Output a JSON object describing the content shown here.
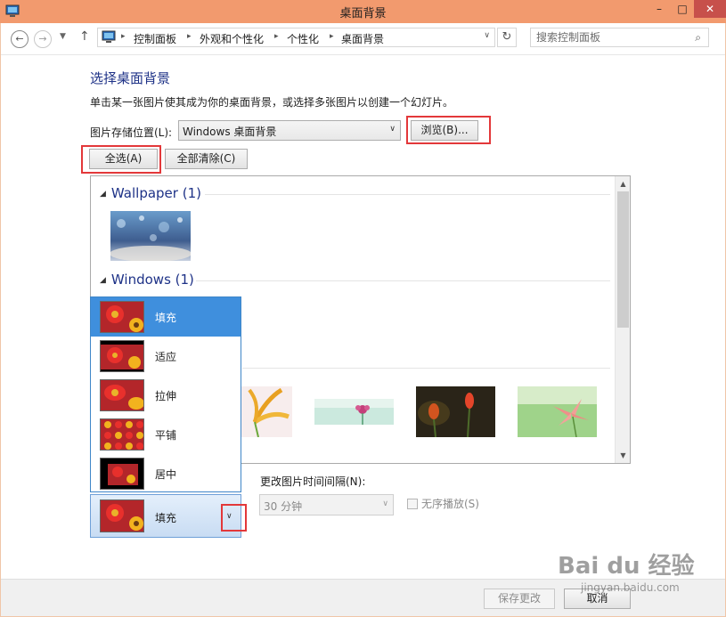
{
  "window": {
    "title": "桌面背景",
    "minimize": "–",
    "maximize": "□",
    "close": "✕"
  },
  "address": {
    "back": "←",
    "forward": "→",
    "history": "▼",
    "up": "↑",
    "breadcrumbs": [
      "控制面板",
      "外观和个性化",
      "个性化",
      "桌面背景"
    ],
    "separator": "▸",
    "dropdown": "∨",
    "refresh": "↻",
    "search_placeholder": "搜索控制面板",
    "search_icon": "⌕"
  },
  "main": {
    "heading": "选择桌面背景",
    "description": "单击某一张图片使其成为你的桌面背景，或选择多张图片以创建一个幻灯片。",
    "location_label": "图片存储位置(L):",
    "location_value": "Windows 桌面背景",
    "location_arrow": "∨",
    "browse_label": "浏览(B)...",
    "select_all_label": "全选(A)",
    "clear_all_label": "全部清除(C)"
  },
  "gallery": {
    "groups": [
      {
        "label": "Wallpaper (1)",
        "expander": "◢"
      },
      {
        "label": "Windows (1)",
        "expander": "◢"
      }
    ],
    "scroll_up": "▲",
    "scroll_down": "▼"
  },
  "position_menu": {
    "items": [
      "填充",
      "适应",
      "拉伸",
      "平铺",
      "居中"
    ],
    "selected_index": 0,
    "current": "填充",
    "arrow": "∨"
  },
  "slideshow": {
    "interval_label": "更改图片时间间隔(N):",
    "interval_value": "30 分钟",
    "interval_arrow": "∨",
    "shuffle_label": "无序播放(S)"
  },
  "footer": {
    "save_label": "保存更改",
    "cancel_label": "取消"
  },
  "watermark": {
    "brand": "Bai du 经验",
    "url": "jingyan.baidu.com"
  },
  "colors": {
    "titlebar": "#f29a6e",
    "close": "#c7504b",
    "accent": "#1e3287",
    "highlight": "#e3383a",
    "selected": "#3f8fdd"
  }
}
